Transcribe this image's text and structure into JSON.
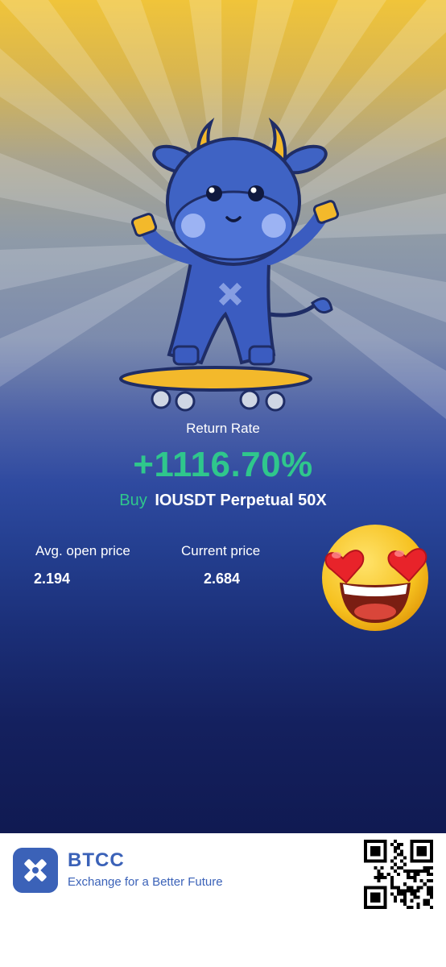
{
  "card": {
    "return_label": "Return Rate",
    "return_value": "+1116.70%",
    "side": "Buy",
    "pair": "IOUSDT Perpetual 50X",
    "avg_open_label": "Avg. open price",
    "avg_open_value": "2.194",
    "current_label": "Current price",
    "current_value": "2.684"
  },
  "footer": {
    "brand": "BTCC",
    "slogan": "Exchange for a Better Future"
  },
  "colors": {
    "accent_green": "#2fc78c",
    "brand_blue": "#3b62b8",
    "top_gold": "#f0c43a",
    "bottom_navy": "#101a52"
  },
  "icons": {
    "mascot": "bull-skateboard-mascot",
    "emoji": "heart-eyes-emoji",
    "logo": "btcc-x-logo",
    "qr": "qr-code"
  }
}
